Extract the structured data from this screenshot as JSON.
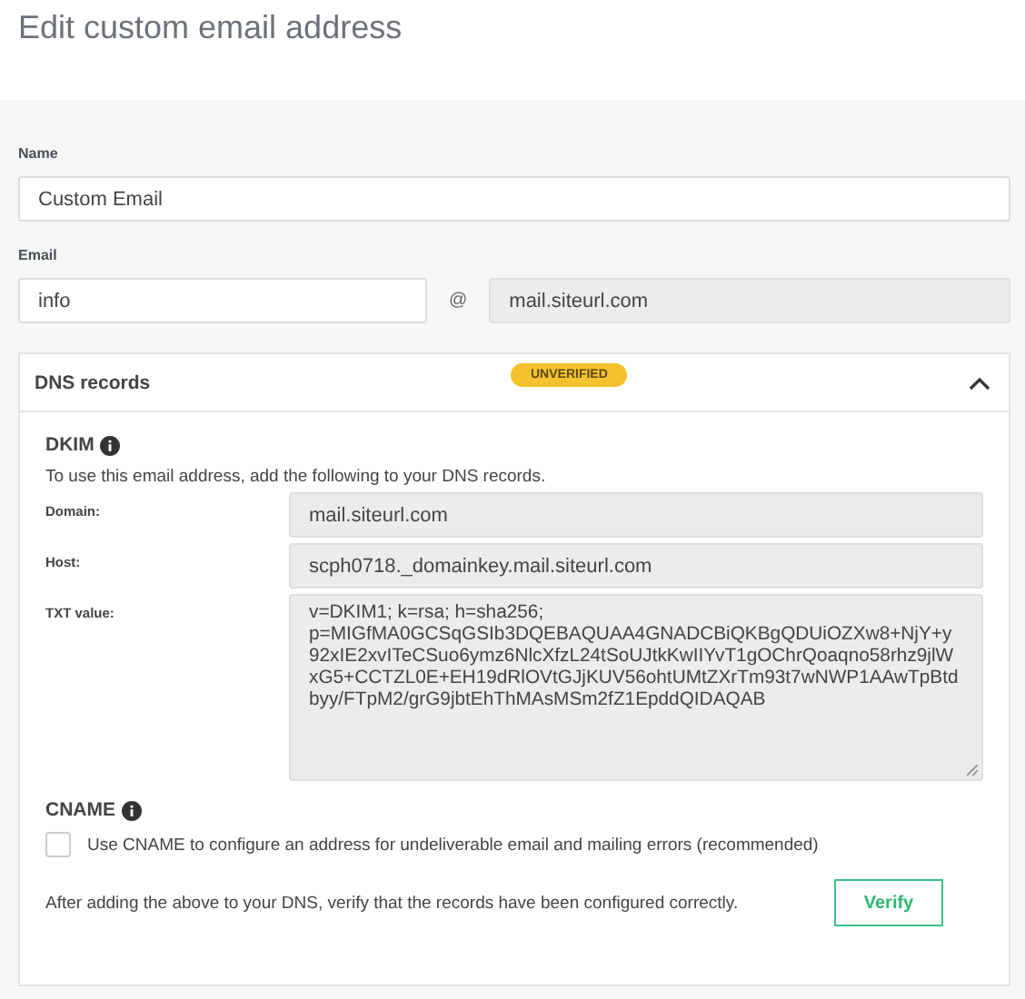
{
  "page_title": "Edit custom email address",
  "name_field": {
    "label": "Name",
    "value": "Custom Email"
  },
  "email_field": {
    "label": "Email",
    "value": "info",
    "separator": "@",
    "domain": "mail.siteurl.com"
  },
  "dns_panel": {
    "title": "DNS records",
    "status": "UNVERIFIED",
    "expanded": true,
    "dkim": {
      "title": "DKIM",
      "description": "To use this email address, add the following to your DNS records.",
      "records": [
        {
          "label": "Domain:",
          "value": "mail.siteurl.com"
        },
        {
          "label": "Host:",
          "value": "scph0718._domainkey.mail.siteurl.com"
        }
      ],
      "txt": {
        "label": "TXT value:",
        "lines": [
          "v=DKIM1; k=rsa; h=sha256;",
          "p=MIGfMA0GCSqGSIb3DQEBAQUAA4GNADCBiQKBgQDUiOZXw8+NjY+y",
          "92xIE2xvITeCSuo6ymz6NlcXfzL24tSoUJtkKwIIYvT1gOChrQoaqno58rhz9jlW",
          "xG5+CCTZL0E+EH19dRlOVtGJjKUV56ohtUMtZXrTm93t7wNWP1AAwTpBtd",
          "byy/FTpM2/grG9jbtEhThMAsMSm2fZ1EpddQIDAQAB"
        ]
      }
    },
    "cname": {
      "title": "CNAME",
      "checkbox_label": "Use CNAME to configure an address for undeliverable email and mailing errors (recommended)",
      "checked": false
    },
    "footer_text": "After adding the above to your DNS, verify that the records have been configured correctly.",
    "verify_button": "Verify"
  }
}
